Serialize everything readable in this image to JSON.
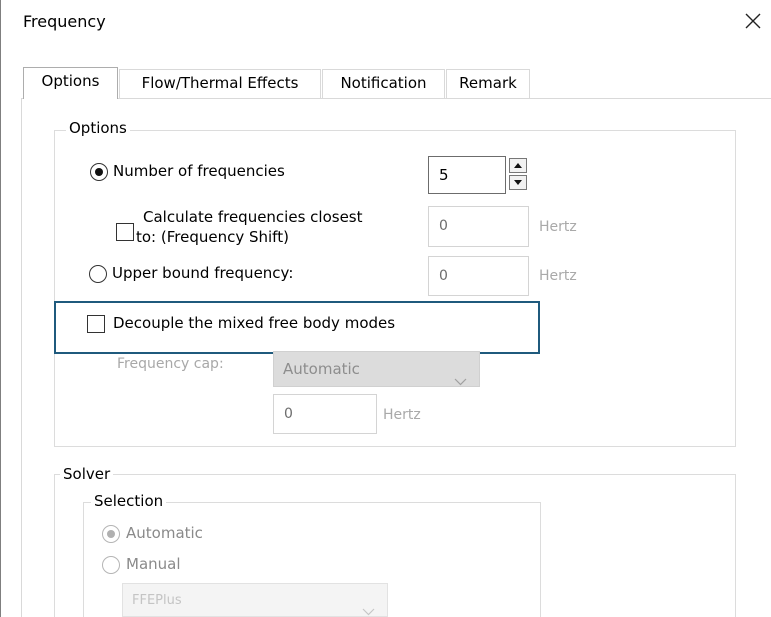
{
  "window": {
    "title": "Frequency"
  },
  "tabs": [
    {
      "label": "Options",
      "active": true
    },
    {
      "label": "Flow/Thermal Effects",
      "active": false
    },
    {
      "label": "Notification",
      "active": false
    },
    {
      "label": "Remark",
      "active": false
    }
  ],
  "options_group": {
    "legend": "Options",
    "number_of_frequencies": {
      "label": "Number of frequencies",
      "checked": true,
      "value": "5"
    },
    "closest_to": {
      "label_line1": "Calculate frequencies closest",
      "label_line2": "to: (Frequency Shift)",
      "checked": false,
      "value": "0",
      "unit": "Hertz"
    },
    "upper_bound": {
      "label": "Upper bound frequency:",
      "checked": false,
      "value": "0",
      "unit": "Hertz"
    },
    "decouple": {
      "label": "Decouple the mixed free body modes",
      "checked": false
    },
    "frequency_cap": {
      "label": "Frequency cap:",
      "selected": "Automatic",
      "value": "0",
      "unit": "Hertz"
    }
  },
  "solver_group": {
    "legend": "Solver",
    "selection_legend": "Selection",
    "automatic_label": "Automatic",
    "manual_label": "Manual",
    "solver_selected": "FFEPlus"
  },
  "colors": {
    "focus_border": "#1f5a7d",
    "disabled_text": "#a8a8a8"
  }
}
